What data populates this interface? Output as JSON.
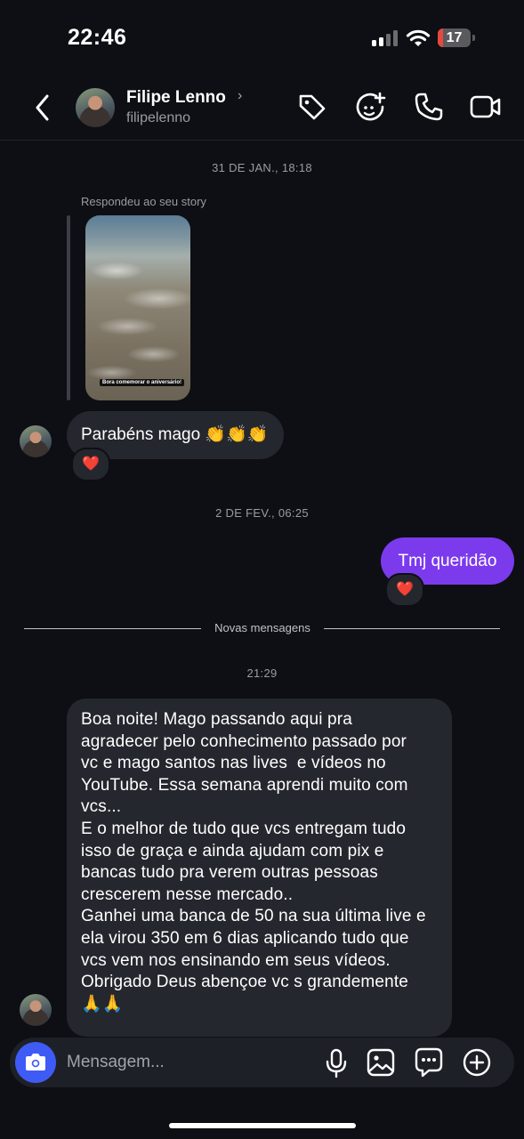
{
  "status_bar": {
    "time": "22:46",
    "battery_level": "17",
    "battery_fraction": 0.17
  },
  "header": {
    "back_icon": "chevron-left-icon",
    "contact_name": "Filipe Lenno",
    "username": "filipelenno",
    "actions": [
      "tag-icon",
      "add-sticker-icon",
      "phone-icon",
      "video-camera-icon"
    ]
  },
  "chat": {
    "timestamp_1": "31 DE JAN., 18:18",
    "reply_label": "Respondeu ao seu story",
    "story_caption": "Bora comemorar o aniversário!",
    "message_1": "Parabéns mago 👏👏👏",
    "message_1_reaction": "❤️",
    "timestamp_2": "2 DE FEV., 06:25",
    "message_2": "Tmj queridão",
    "message_2_reaction": "❤️",
    "new_messages_label": "Novas mensagens",
    "timestamp_3": "21:29",
    "message_3": "Boa noite! Mago passando aqui pra\nagradecer pelo conhecimento passado por\nvc e mago santos nas lives  e vídeos no\nYouTube. Essa semana aprendi muito com\nvcs...\nE o melhor de tudo que vcs entregam tudo\nisso de graça e ainda ajudam com pix e\nbancas tudo pra verem outras pessoas\ncrescerem nesse mercado..\nGanhei uma banca de 50 na sua última live e\nela virou 350 em 6 dias aplicando tudo que\nvcs vem nos ensinando em seus vídeos.\nObrigado Deus abençoe vc s grandemente\n🙏🙏"
  },
  "composer": {
    "placeholder": "Mensagem...",
    "icons": [
      "camera-icon",
      "microphone-icon",
      "gallery-icon",
      "chat-bubble-icon",
      "plus-circle-icon"
    ]
  },
  "colors": {
    "background": "#0d0f14",
    "incoming_bubble": "#25272e",
    "outgoing_bubble": "#7c3aed",
    "camera_button": "#3f5bf5",
    "battery_low": "#e5483e"
  }
}
